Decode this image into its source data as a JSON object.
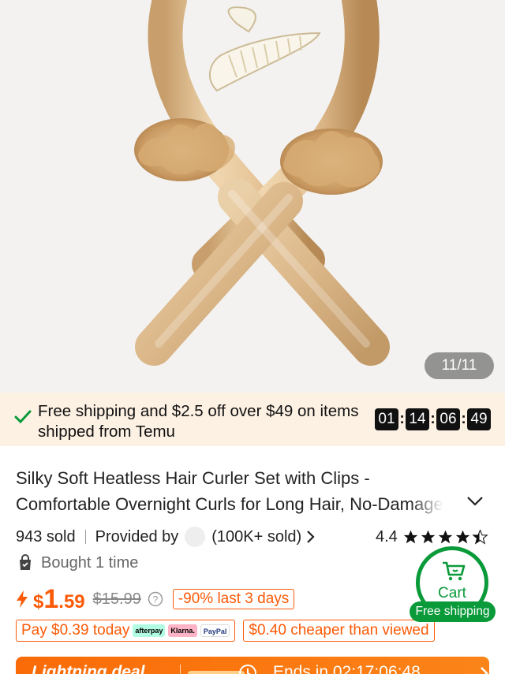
{
  "gallery": {
    "counter": "11/11"
  },
  "shipping_bar": {
    "text": "Free shipping and $2.5 off over $49 on items shipped from Temu",
    "timer": [
      "01",
      "14",
      "06",
      "49"
    ]
  },
  "product": {
    "title": "Silky Soft Heatless Hair Curler Set with Clips - Comfortable Overnight Curls for Long Hair, No-Damage",
    "sold": "943 sold",
    "provided_by": "Provided by",
    "store_sold": "(100K+ sold)",
    "rating": "4.4",
    "rating_stars": 4.4,
    "bought": "Bought 1 time"
  },
  "price": {
    "currency": "$",
    "integer": "1",
    "decimal": ".59",
    "original": "$15.99",
    "discount": "-90% last 3 days"
  },
  "badges": {
    "pay_today": "Pay $0.39 today",
    "pay_logos": [
      "afterpay",
      "Klarna.",
      "PayPal"
    ],
    "cheaper": "$0.40 cheaper than viewed"
  },
  "cart": {
    "label": "Cart",
    "free_shipping": "Free shipping"
  },
  "deal": {
    "title": "Lightning deal",
    "ends": "Ends in 02:17:06:48"
  },
  "colors": {
    "accent": "#fb5a07",
    "green": "#0a9a3a",
    "ship_bg": "#fdf1e4"
  }
}
